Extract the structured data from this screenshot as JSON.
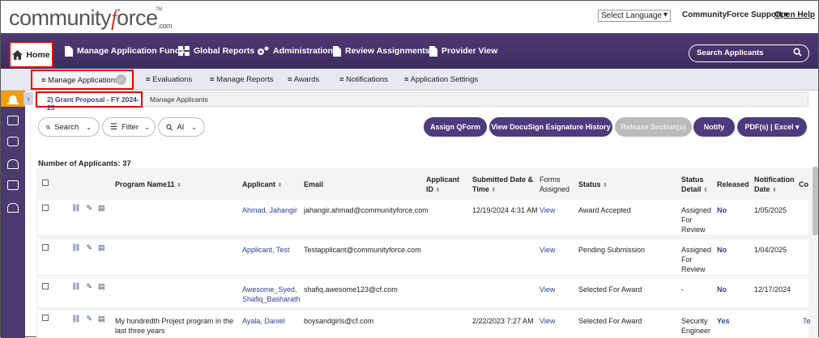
{
  "brand": {
    "logo_pre": "community",
    "logo_f": "f",
    "logo_post": "orce",
    "logo_com": ".com",
    "logo_tm": "TM"
  },
  "header": {
    "language": "Select Language",
    "support": "CommunityForce Support ▾",
    "help": "Open Help"
  },
  "mainnav": {
    "home": "Home",
    "funds": "Manage Application Funds",
    "reports": "Global Reports",
    "admin": "Administration",
    "review": "Review Assignments",
    "provider": "Provider View",
    "search_placeholder": "Search Applicants"
  },
  "subnav": {
    "manage_apps": "≡ Manage Applications",
    "evaluations": "≡ Evaluations",
    "manage_reports": "≡ Manage Reports",
    "awards": "≡ Awards",
    "notifications": "≡ Notifications",
    "app_settings": "≡ Application Settings"
  },
  "breadcrumb": {
    "current": "2) Grant Proposal - FY 2024-25",
    "next": "Manage Applicants"
  },
  "toolbar": {
    "search": "Search",
    "filter": "Filter",
    "ai": "AI",
    "assign_qform": "Assign QForm",
    "docusign": "View DocuSign Esignature History",
    "release": "Release Section(s)",
    "notify": "Notify",
    "pdf_excel": "PDF(s) | Excel ▾"
  },
  "count_label": "Number of Applicants: 37",
  "columns": {
    "program": "Program Name11",
    "applicant": "Applicant",
    "email": "Email",
    "applicant_id_1": "Applicant",
    "applicant_id_2": "ID",
    "submitted_1": "Submitted Date &",
    "submitted_2": "Time",
    "forms_1": "Forms",
    "forms_2": "Assigned",
    "status": "Status",
    "status_detail_1": "Status",
    "status_detail_2": "Detail",
    "released": "Released",
    "notification_1": "Notification",
    "notification_2": "Date",
    "co": "Co"
  },
  "rows": [
    {
      "program": "",
      "applicant": "Ahmad, Jahangir",
      "applicant2": "",
      "email": "jahangir.ahmad@communityforce.com",
      "submitted": "12/19/2024 4:31 AM",
      "forms": "View",
      "status": "Award Accepted",
      "detail1": "Assigned",
      "detail2": "For",
      "detail3": "Review",
      "released": "No",
      "notif": "1/05/2025",
      "co": ""
    },
    {
      "program": "",
      "applicant": "Applicant, Test",
      "applicant2": "",
      "email": "Testapplicant@communityforce.com",
      "submitted": "",
      "forms": "View",
      "status": "Pending Submission",
      "detail1": "Assigned",
      "detail2": "For",
      "detail3": "Review",
      "released": "No",
      "notif": "1/04/2025",
      "co": ""
    },
    {
      "program": "",
      "applicant": "Awesome_Syed,",
      "applicant2": "Shafiq_Basharath",
      "email": "shafiq.awesome123@cf.com",
      "submitted": "",
      "forms": "View",
      "status": "Selected For Award",
      "detail1": "-",
      "detail2": "",
      "detail3": "",
      "released": "No",
      "notif": "12/17/2024",
      "co": ""
    },
    {
      "program": "My hundredth  Project program in the",
      "program2": "last three years",
      "applicant": "Ayala, Daniel",
      "applicant2": "",
      "email": "boysandgirls@cf.com",
      "submitted": "2/22/2023 7:27 AM",
      "forms": "View",
      "status": "Selected For Award",
      "detail1": "Security",
      "detail2": "Engineer",
      "detail3": "",
      "released": "Yes",
      "notif": "",
      "co": "Te"
    }
  ]
}
